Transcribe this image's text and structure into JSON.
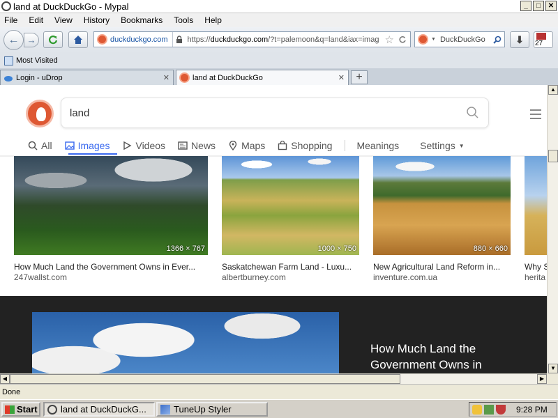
{
  "window": {
    "title": "land at DuckDuckGo - Mypal",
    "controls": [
      "_",
      "□",
      "✕"
    ]
  },
  "menu": [
    "File",
    "Edit",
    "View",
    "History",
    "Bookmarks",
    "Tools",
    "Help"
  ],
  "nav": {
    "site_identity": "duckduckgo.com",
    "url_prefix": "https://",
    "url_domain": "duckduckgo.com",
    "url_rest": "/?t=palemoon&q=land&iax=imag",
    "search_engine": "DuckDuckGo",
    "downloads_badge": "27"
  },
  "bookmarks": {
    "most_visited": "Most Visited"
  },
  "tabs": [
    {
      "label": "Login - uDrop"
    },
    {
      "label": "land at DuckDuckGo"
    }
  ],
  "search": {
    "query": "land",
    "filters": [
      "All",
      "Images",
      "Videos",
      "News",
      "Maps",
      "Shopping",
      "Meanings",
      "Settings"
    ],
    "active_filter": "Images"
  },
  "results": [
    {
      "title": "How Much Land the Government Owns in Ever...",
      "source": "247wallst.com",
      "dims": "1366 × 767"
    },
    {
      "title": "Saskatchewan Farm Land - Luxu...",
      "source": "albertburney.com",
      "dims": "1000 × 750"
    },
    {
      "title": "New Agricultural Land Reform in...",
      "source": "inventure.com.ua",
      "dims": "880 × 660"
    },
    {
      "title": "Why S",
      "source": "herita",
      "dims": ""
    }
  ],
  "detail": {
    "title": "How Much Land the Government Owns in"
  },
  "status": "Done",
  "taskbar": {
    "start": "Start",
    "items": [
      "land at DuckDuckG...",
      "TuneUp Styler"
    ],
    "clock": "9:28 PM"
  },
  "colors": {
    "accent": "#3969ef",
    "ddg_orange": "#de5833"
  }
}
